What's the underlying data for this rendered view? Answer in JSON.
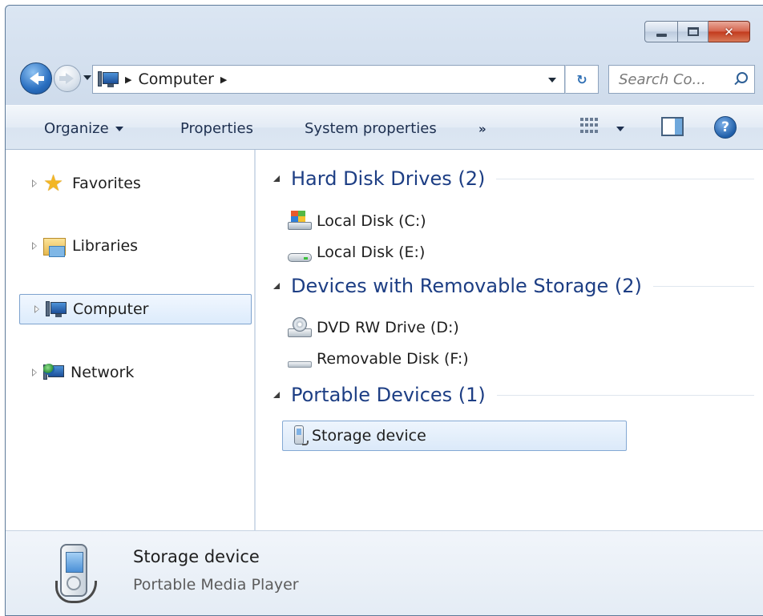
{
  "window": {
    "caption_buttons": {
      "minimize": "",
      "maximize": "",
      "close": "✕"
    }
  },
  "nav": {
    "breadcrumb": "Computer",
    "search_placeholder": "Search Co..."
  },
  "toolbar": {
    "organize": "Organize",
    "properties": "Properties",
    "system_properties": "System properties",
    "more": "»"
  },
  "sidebar": {
    "items": [
      {
        "label": "Favorites",
        "icon": "star-icon",
        "selected": false
      },
      {
        "label": "Libraries",
        "icon": "libraries-icon",
        "selected": false
      },
      {
        "label": "Computer",
        "icon": "computer-icon",
        "selected": true
      },
      {
        "label": "Network",
        "icon": "network-icon",
        "selected": false
      }
    ]
  },
  "groups": [
    {
      "title": "Hard Disk Drives (2)",
      "items": [
        {
          "label": "Local Disk (C:)",
          "icon": "windows-disk-icon"
        },
        {
          "label": "Local Disk (E:)",
          "icon": "hard-disk-icon"
        }
      ]
    },
    {
      "title": "Devices with Removable Storage (2)",
      "items": [
        {
          "label": "DVD RW Drive (D:)",
          "icon": "dvd-drive-icon"
        },
        {
          "label": "Removable Disk (F:)",
          "icon": "removable-disk-icon"
        }
      ]
    },
    {
      "title": "Portable Devices (1)",
      "items": [
        {
          "label": "Storage device",
          "icon": "portable-device-icon",
          "selected": true
        }
      ]
    }
  ],
  "details": {
    "name": "Storage device",
    "type": "Portable Media Player"
  },
  "colors": {
    "group_title": "#1d3e84",
    "selection_border": "#7da2ce",
    "close_button": "#c2391c"
  }
}
